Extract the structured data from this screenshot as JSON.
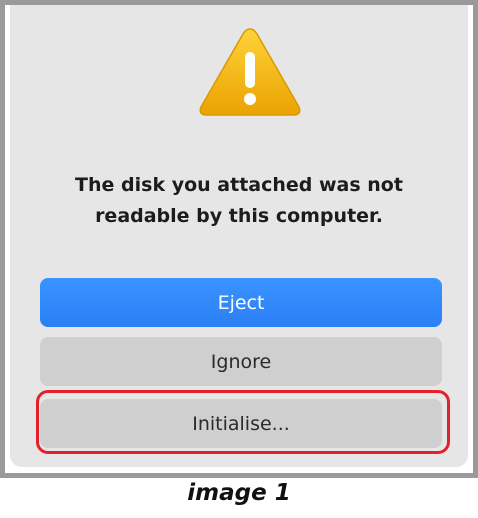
{
  "dialog": {
    "message_line1": "The disk you attached was not",
    "message_line2": "readable by this computer.",
    "icon": "warning-icon",
    "buttons": {
      "eject_label": "Eject",
      "ignore_label": "Ignore",
      "initialise_label": "Initialise..."
    }
  },
  "caption": "image 1",
  "colors": {
    "primary_button": "#2a84fa",
    "secondary_button": "#cfcfcf",
    "highlight": "#e4202a",
    "warning": "#f4b800"
  }
}
